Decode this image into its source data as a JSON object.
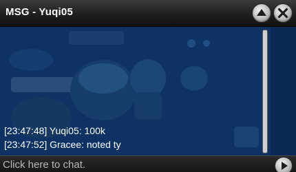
{
  "window": {
    "title": "MSG - Yuqi05"
  },
  "header_buttons": {
    "minimize_icon": "triangle-up-icon",
    "close_icon": "close-x-icon"
  },
  "messages": [
    {
      "text": "[23:47:48] Yuqi05: 100k"
    },
    {
      "text": "[23:47:52] Gracee: noted ty"
    }
  ],
  "chat_input": {
    "placeholder": "Click here to chat."
  },
  "send_button": {
    "icon": "play-triangle-icon"
  },
  "colors": {
    "titlebar": "#1f1f1f",
    "chat_background": "#0d3263",
    "text": "#ffffff"
  }
}
